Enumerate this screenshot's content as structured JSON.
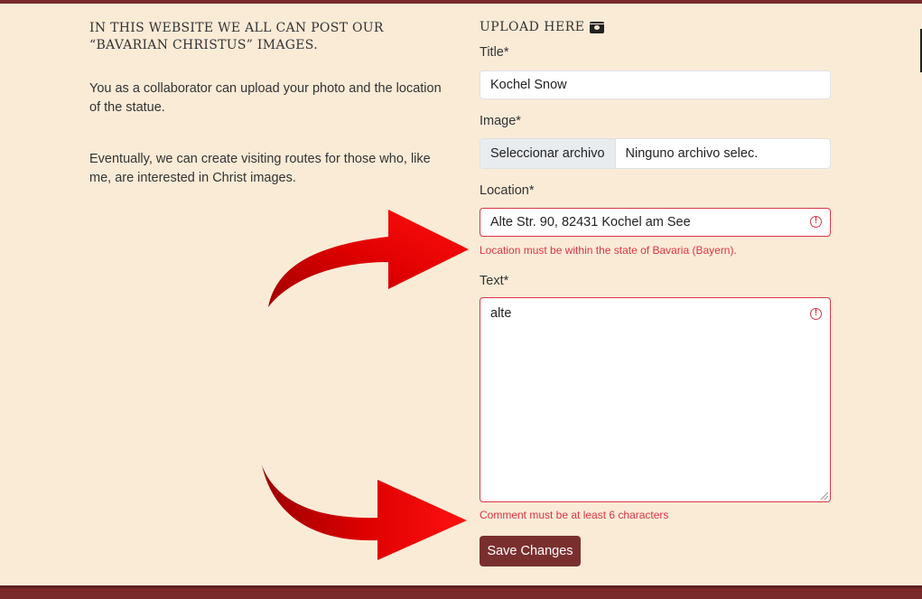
{
  "intro": {
    "heading": "In this website we all can post our “Bavarian Christus” images.",
    "paragraph1": "You as a collaborator can upload your photo and the location of the statue.",
    "paragraph2": "Eventually, we can create visiting routes for those who, like me, are interested in Christ images."
  },
  "form": {
    "heading": "Upload Here",
    "heading_icon": "camera-icon",
    "title": {
      "label": "Title*",
      "value": "Kochel Snow"
    },
    "image": {
      "label": "Image*",
      "button": "Seleccionar archivo",
      "status": "Ninguno archivo selec."
    },
    "location": {
      "label": "Location*",
      "value": "Alte Str. 90, 82431 Kochel am See",
      "error": "Location must be within the state of Bavaria (Bayern)."
    },
    "text": {
      "label": "Text*",
      "value": "alte",
      "error": "Comment must be at least 6 characters"
    },
    "submit_label": "Save Changes",
    "invalid_marker": "!"
  },
  "colors": {
    "background": "#faebd7",
    "accent": "#7a2f2f",
    "error": "#dc3545",
    "annotation_arrow": "#e00000"
  }
}
